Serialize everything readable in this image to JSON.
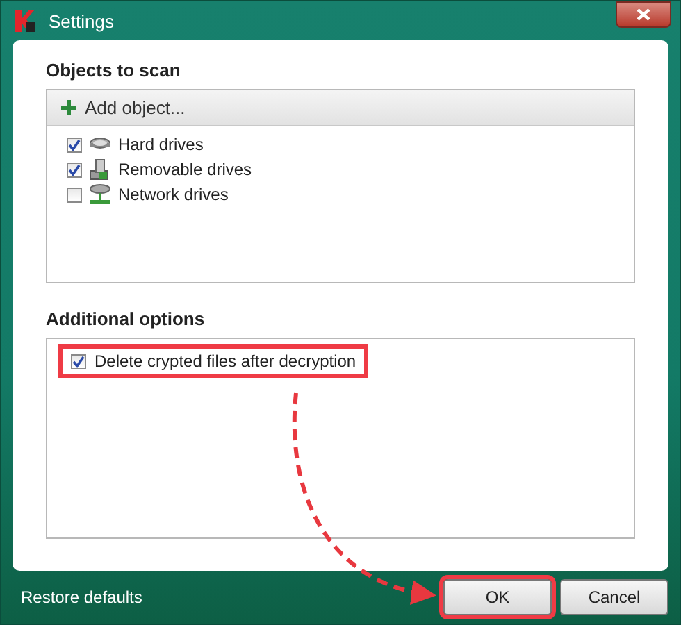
{
  "window": {
    "title": "Settings"
  },
  "objects_to_scan": {
    "heading": "Objects to scan",
    "add_button": "Add object...",
    "items": [
      {
        "label": "Hard drives",
        "checked": true,
        "kind": "hdd"
      },
      {
        "label": "Removable drives",
        "checked": true,
        "kind": "usb"
      },
      {
        "label": "Network drives",
        "checked": false,
        "kind": "network"
      }
    ]
  },
  "additional_options": {
    "heading": "Additional options",
    "items": [
      {
        "label": "Delete crypted files after decryption",
        "checked": true,
        "highlighted": true
      }
    ]
  },
  "footer": {
    "restore_link": "Restore defaults",
    "buttons": [
      {
        "label": "OK",
        "highlighted": true
      },
      {
        "label": "Cancel",
        "highlighted": false
      }
    ]
  }
}
